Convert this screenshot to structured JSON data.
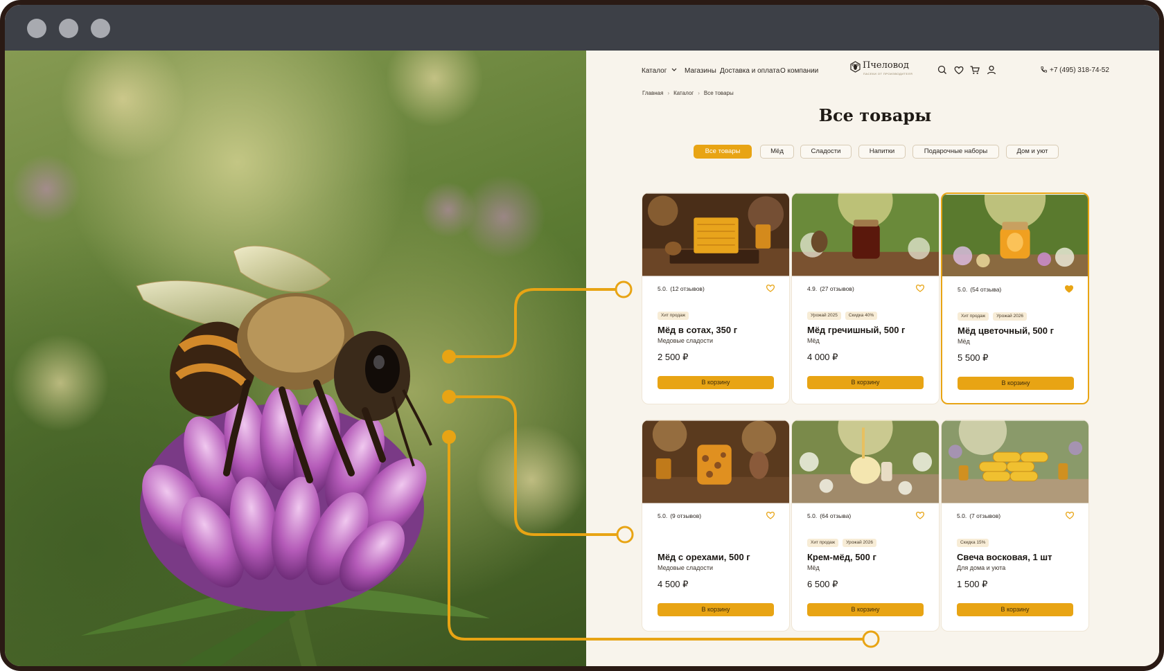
{
  "brand": {
    "name": "Пчеловод",
    "tagline": "ПАСЕКИ ОТ ПРОИЗВОДИТЕЛЯ"
  },
  "nav": {
    "items": [
      "Каталог",
      "Магазины",
      "Доставка и оплата",
      "О компании"
    ],
    "phone": "+7 (495) 318-74-52",
    "icons": [
      "search-icon",
      "heart-icon",
      "cart-icon",
      "user-icon",
      "phone-icon"
    ]
  },
  "breadcrumbs": [
    "Главная",
    "Каталог",
    "Все товары"
  ],
  "page_title": "Все товары",
  "tabs": [
    {
      "label": "Все товары",
      "active": true
    },
    {
      "label": "Мёд",
      "active": false
    },
    {
      "label": "Сладости",
      "active": false
    },
    {
      "label": "Напитки",
      "active": false
    },
    {
      "label": "Подарочные наборы",
      "active": false
    },
    {
      "label": "Дом и уют",
      "active": false
    }
  ],
  "colors": {
    "accent": "#e8a414",
    "background": "#f8f4ec",
    "titlebar": "#3d4047"
  },
  "products": [
    {
      "rating": "5.0.",
      "reviews": "(12 отзывов)",
      "badges": [
        "Хит продаж"
      ],
      "title": "Мёд в сотах, 350 г",
      "category": "Медовые сладости",
      "price": "2 500 ₽",
      "button": "В корзину",
      "favorited": false
    },
    {
      "rating": "4.9.",
      "reviews": "(27 отзывов)",
      "badges": [
        "Урожай 2025",
        "Скидка 40%"
      ],
      "title": "Мёд гречишный, 500 г",
      "category": "Мёд",
      "price": "4 000 ₽",
      "button": "В корзину",
      "favorited": false
    },
    {
      "rating": "5.0.",
      "reviews": "(54 отзыва)",
      "badges": [
        "Хит продаж",
        "Урожай 2026"
      ],
      "title": "Мёд цветочный, 500 г",
      "category": "Мёд",
      "price": "5 500 ₽",
      "button": "В корзину",
      "favorited": true
    },
    {
      "rating": "5.0.",
      "reviews": "(9 отзывов)",
      "badges": [],
      "title": "Мёд с орехами, 500 г",
      "category": "Медовые сладости",
      "price": "4 500 ₽",
      "button": "В корзину",
      "favorited": false
    },
    {
      "rating": "5.0.",
      "reviews": "(64 отзыва)",
      "badges": [
        "Хит продаж",
        "Урожай 2026"
      ],
      "title": "Крем-мёд, 500 г",
      "category": "Мёд",
      "price": "6 500 ₽",
      "button": "В корзину",
      "favorited": false
    },
    {
      "rating": "5.0.",
      "reviews": "(7 отзывов)",
      "badges": [
        "Скидка 15%"
      ],
      "title": "Свеча восковая, 1 шт",
      "category": "Для дома и уюта",
      "price": "1 500 ₽",
      "button": "В корзину",
      "favorited": false
    }
  ]
}
